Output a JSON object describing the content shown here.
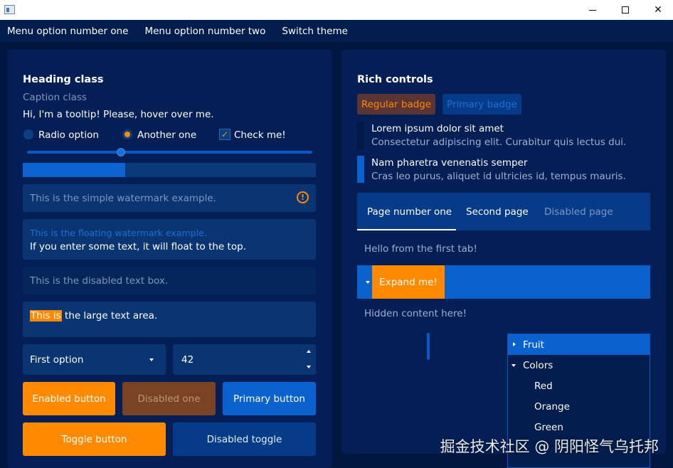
{
  "menu": {
    "items": [
      {
        "label": "Menu option number one"
      },
      {
        "label": "Menu option number two"
      },
      {
        "label": "Switch theme"
      }
    ]
  },
  "left": {
    "heading": "Heading class",
    "caption": "Caption class",
    "tooltip_text": "Hi, I'm a tooltip! Please, hover over me.",
    "radio_option": "Radio option",
    "radio_another": "Another one",
    "checkbox_label": "Check me!",
    "checkbox_mark": "✓",
    "slider_value": 0.33,
    "progress_value": 0.35,
    "watermark_simple": "This is the simple watermark example.",
    "warning_glyph": "!",
    "floating_watermark": "This is the floating watermark example.",
    "floating_value": "If you enter some text, it will float to the top.",
    "disabled_textbox": "This is the disabled text box.",
    "large_text_selected": "This is",
    "large_text_rest": " the large text area.",
    "combo_value": "First option",
    "number_value": "42",
    "btn_enabled": "Enabled button",
    "btn_disabled": "Disabled one",
    "btn_primary": "Primary button",
    "btn_toggle": "Toggle button",
    "btn_disabled_toggle": "Disabled toggle"
  },
  "right": {
    "heading": "Rich controls",
    "badge_regular": "Regular badge",
    "badge_primary": "Primary badge",
    "list": [
      {
        "title": "Lorem ipsum dolor sit amet",
        "subtitle": "Consectetur adipiscing elit. Curabitur quis lectus dui."
      },
      {
        "title": "Nam pharetra venenatis semper",
        "subtitle": "Cras leo purus, aliquet id ultricies id, tempus mauris."
      }
    ],
    "tabs": [
      {
        "label": "Page number one"
      },
      {
        "label": "Second page"
      },
      {
        "label": "Disabled page"
      }
    ],
    "tab_content": "Hello from the first tab!",
    "expander_label": "Expand me!",
    "expander_hidden": "Hidden content here!",
    "tree": [
      {
        "label": "Fruit"
      },
      {
        "label": "Colors"
      },
      {
        "label": "Red"
      },
      {
        "label": "Orange"
      },
      {
        "label": "Green"
      }
    ]
  },
  "overlay_watermark": "掘金技术社区 @ 阴阳怪气乌托邦",
  "colors": {
    "background": "#02173f",
    "panel": "#031f55",
    "accent": "#ff8a00",
    "primary": "#0a62ce"
  }
}
